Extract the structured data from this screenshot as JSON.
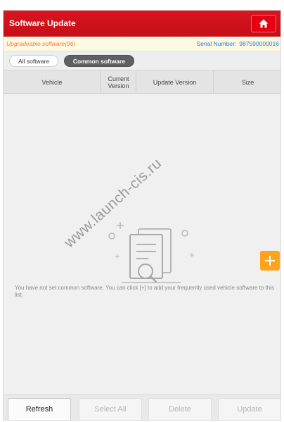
{
  "header": {
    "title": "Software Update",
    "home_icon": "home-icon"
  },
  "info_bar": {
    "upgradeable": "Upgradeable software(96)",
    "serial_label": "Serial Number:",
    "serial_value": "987590000016"
  },
  "tabs": [
    {
      "label": "All software",
      "selected": false
    },
    {
      "label": "Common software",
      "selected": true
    }
  ],
  "table": {
    "columns": [
      "Vehicle",
      "Current Version",
      "Update Version",
      "Size"
    ],
    "rows": []
  },
  "empty_state": {
    "icon": "document-search-icon",
    "message": "You have not set common software. You can click [+] to add your frequently used vehicle software to this list."
  },
  "watermark": "www.launch-cis.ru",
  "fab": {
    "icon": "plus-icon"
  },
  "bottom_bar": {
    "refresh": "Refresh",
    "select_all": "Select All",
    "delete": "Delete",
    "update": "Update"
  },
  "colors": {
    "header_red": "#d9141f",
    "accent_orange": "#ffa31a",
    "serial_blue": "#1f7fd1",
    "upgradeable_orange": "#f07a43"
  }
}
